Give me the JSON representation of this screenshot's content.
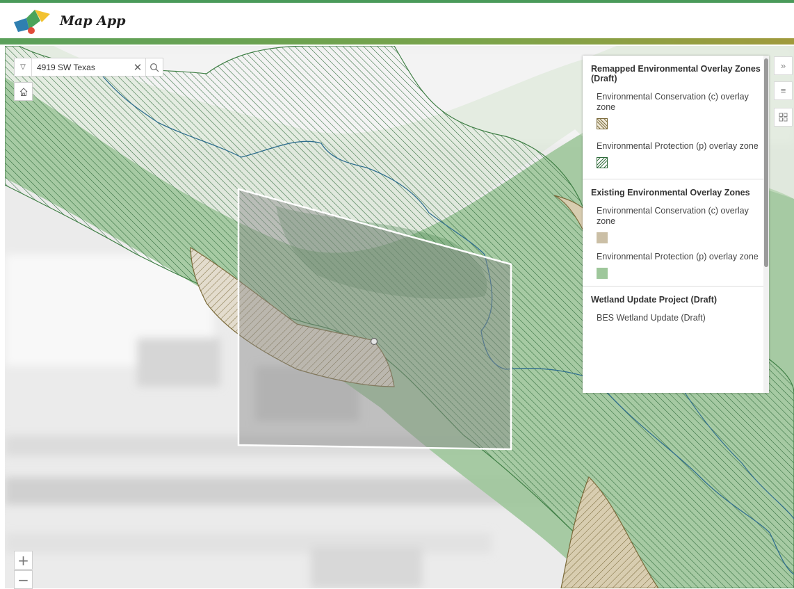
{
  "app": {
    "title": "Map App"
  },
  "search": {
    "value": "4919 SW Texas",
    "dropdown_icon": "triangle-down-icon",
    "clear_icon": "close-icon",
    "search_icon": "search-icon"
  },
  "controls": {
    "home_icon": "home-icon",
    "zoom_in_icon": "plus-icon",
    "zoom_out_icon": "minus-icon"
  },
  "side_buttons": [
    {
      "icon": "double-chevron-right-icon"
    },
    {
      "icon": "list-icon"
    },
    {
      "icon": "grid-icon"
    }
  ],
  "legend": {
    "sections": [
      {
        "heading": "Remapped Environmental Overlay Zones (Draft)",
        "items": [
          {
            "label": "Environmental Conservation (c) overlay zone",
            "swatch": "hatch-brown"
          },
          {
            "label": "Environmental Protection (p) overlay zone",
            "swatch": "hatch-green"
          }
        ]
      },
      {
        "heading": "Existing Environmental Overlay Zones",
        "items": [
          {
            "label": "Environmental Conservation (c) overlay zone",
            "swatch": "fill-tan"
          },
          {
            "label": "Environmental Protection (p) overlay zone",
            "swatch": "fill-green"
          }
        ]
      },
      {
        "heading": "Wetland Update Project (Draft)",
        "items": [
          {
            "label": "BES Wetland Update (Draft)",
            "swatch": ""
          }
        ]
      }
    ]
  },
  "colors": {
    "header_accent": "#5aa05a",
    "protection_green": "#8fbf8f",
    "conservation_tan": "#cbbfa6",
    "hatch_green": "#2e6a3a",
    "hatch_brown": "#7a6a3a",
    "stream_blue": "#2f6e8e"
  }
}
